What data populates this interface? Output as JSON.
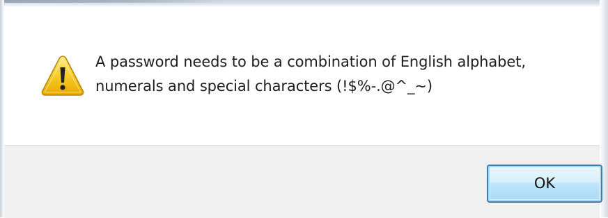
{
  "dialog": {
    "icon": "warning-icon",
    "message_lines": [
      "A password needs to be a combination of English alphabet,",
      "numerals and special characters (!$%-.@^_~)"
    ],
    "ok_label": "OK"
  },
  "colors": {
    "footer_bg": "#f0f0f0",
    "button_border": "#3c7fb1",
    "warning_yellow": "#f5c400"
  }
}
